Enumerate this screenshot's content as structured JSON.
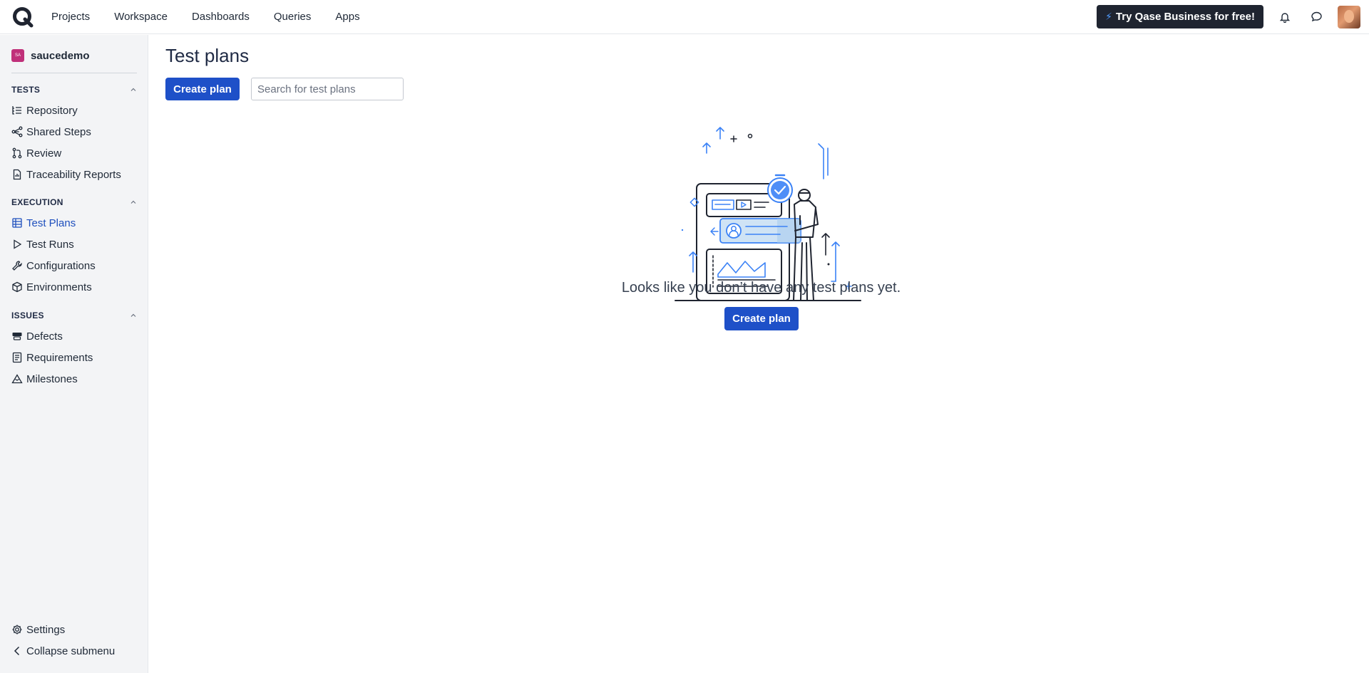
{
  "topnav": {
    "links": [
      "Projects",
      "Workspace",
      "Dashboards",
      "Queries",
      "Apps"
    ],
    "promo_label": "Try Qase Business for free!"
  },
  "sidebar": {
    "project_badge": "SA",
    "project_name": "saucedemo",
    "tests": {
      "title": "TESTS",
      "items": [
        "Repository",
        "Shared Steps",
        "Review",
        "Traceability Reports"
      ]
    },
    "execution": {
      "title": "EXECUTION",
      "items": [
        "Test Plans",
        "Test Runs",
        "Configurations",
        "Environments"
      ]
    },
    "issues": {
      "title": "ISSUES",
      "items": [
        "Defects",
        "Requirements",
        "Milestones"
      ]
    },
    "settings_label": "Settings",
    "collapse_label": "Collapse submenu"
  },
  "main": {
    "title": "Test plans",
    "create_label": "Create plan",
    "search_placeholder": "Search for test plans",
    "empty_message": "Looks like you don’t have any test plans yet.",
    "empty_create_label": "Create plan"
  },
  "colors": {
    "primary": "#1e50c8",
    "active_nav": "#1e4fbd",
    "promo_bg": "#1f2430",
    "sidebar_bg": "#f3f4f6",
    "illustration_accent": "#3b82f6"
  }
}
